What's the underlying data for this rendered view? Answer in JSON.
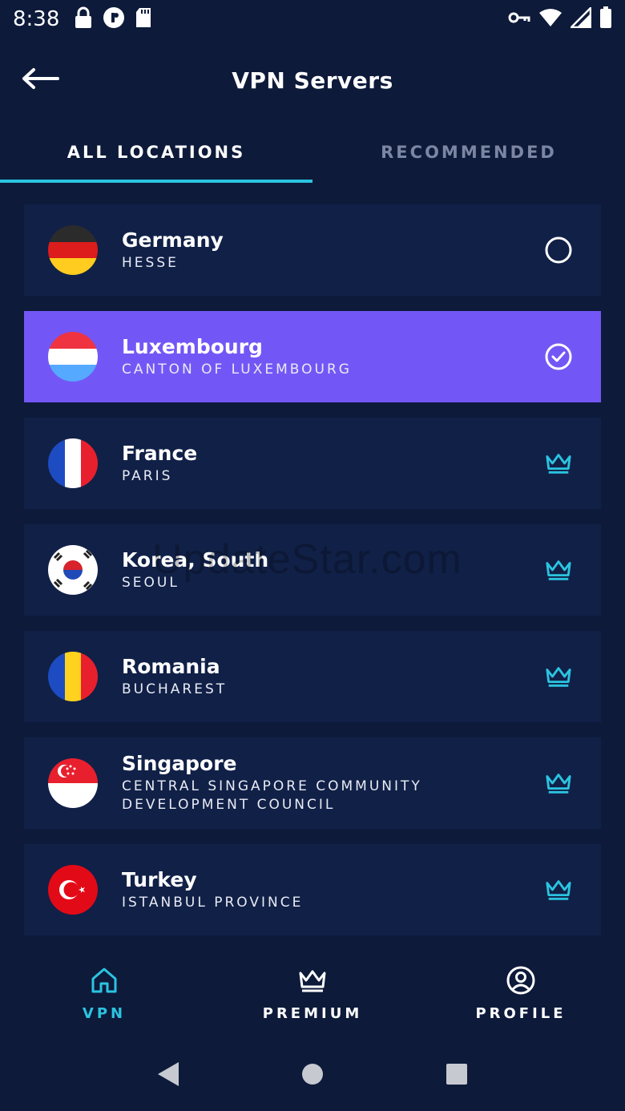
{
  "status_bar": {
    "time": "8:38",
    "left_icons": [
      "lock-icon",
      "vpn-key-circle-icon",
      "sd-card-icon"
    ],
    "right_icons": [
      "vpn-key-icon",
      "wifi-icon",
      "signal-icon",
      "battery-icon"
    ]
  },
  "header": {
    "title": "VPN Servers",
    "back_icon": "arrow-left-icon"
  },
  "tabs": [
    {
      "label": "ALL LOCATIONS",
      "active": true
    },
    {
      "label": "RECOMMENDED",
      "active": false
    }
  ],
  "servers": [
    {
      "country": "Germany",
      "region": "HESSE",
      "flag": "germany-flag-icon",
      "status": "available",
      "selected": false
    },
    {
      "country": "Luxembourg",
      "region": "CANTON OF LUXEMBOURG",
      "flag": "luxembourg-flag-icon",
      "status": "connected",
      "selected": true
    },
    {
      "country": "France",
      "region": "PARIS",
      "flag": "france-flag-icon",
      "status": "premium",
      "selected": false
    },
    {
      "country": "Korea, South",
      "region": "SEOUL",
      "flag": "south-korea-flag-icon",
      "status": "premium",
      "selected": false
    },
    {
      "country": "Romania",
      "region": "BUCHAREST",
      "flag": "romania-flag-icon",
      "status": "premium",
      "selected": false
    },
    {
      "country": "Singapore",
      "region": "CENTRAL SINGAPORE COMMUNITY DEVELOPMENT COUNCIL",
      "flag": "singapore-flag-icon",
      "status": "premium",
      "selected": false
    },
    {
      "country": "Turkey",
      "region": "ISTANBUL PROVINCE",
      "flag": "turkey-flag-icon",
      "status": "premium",
      "selected": false
    }
  ],
  "watermark": "UpdateStar.com",
  "bottom_nav": [
    {
      "label": "VPN",
      "icon": "home-icon",
      "active": true
    },
    {
      "label": "PREMIUM",
      "icon": "crown-icon",
      "active": false
    },
    {
      "label": "PROFILE",
      "icon": "user-circle-icon",
      "active": false
    }
  ],
  "system_nav": [
    "back-triangle-icon",
    "home-circle-icon",
    "recents-square-icon"
  ],
  "colors": {
    "background": "#0d1a3a",
    "card": "#112047",
    "selected_card": "#7357f6",
    "accent": "#2bc4e0",
    "inactive_tab": "#7c86a2"
  }
}
